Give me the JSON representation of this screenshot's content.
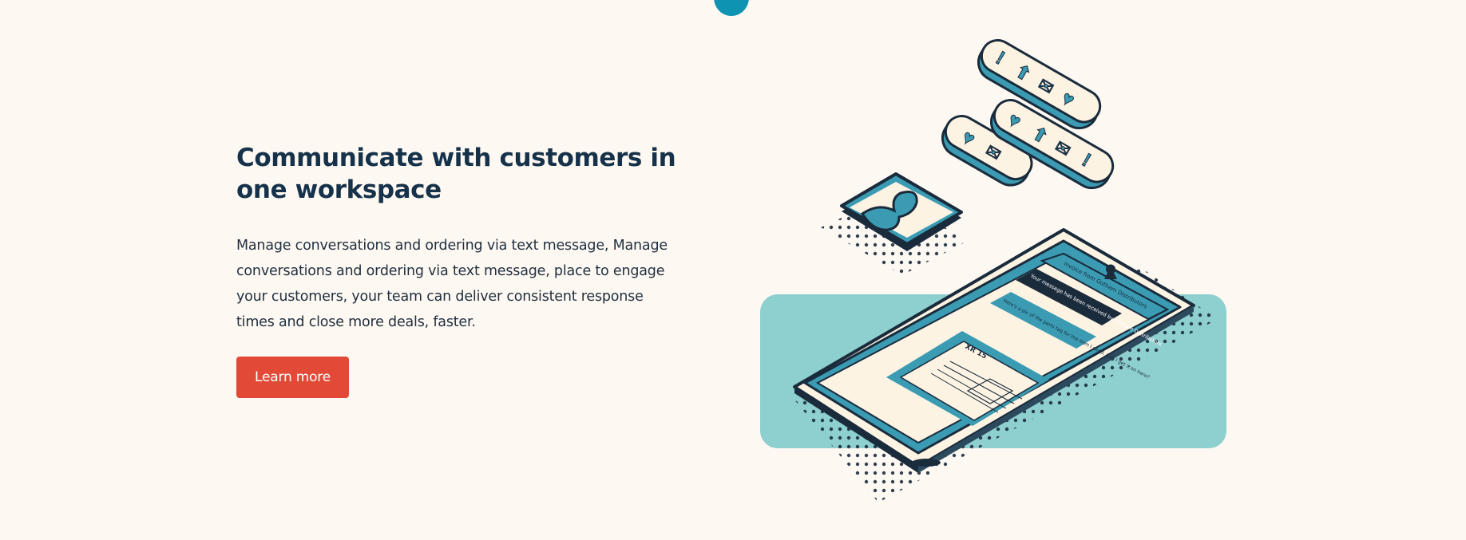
{
  "section": {
    "title": "Communicate with customers in one workspace",
    "description": "Manage conversations and ordering via text message, Manage conversations and ordering via text message, place to engage your customers, your team can deliver consistent response times and close more deals, faster.",
    "cta_label": "Learn more"
  },
  "illustration": {
    "contact_name": "Invoice from Gotham Distributors",
    "message_1": "Your message has been received by Gotham Distributors",
    "message_2": "Here's a pic of the parts tag for the item I need. Can I get it on here?",
    "tag_label": "XR 15",
    "icons": [
      "heart-icon",
      "mail-icon",
      "arrow-up-icon",
      "user-icon",
      "exclamation-icon"
    ]
  },
  "colors": {
    "background": "#fef8f2",
    "heading": "#16324a",
    "accent_teal": "#3a9bb3",
    "light_teal": "#8ecfcf",
    "cta": "#e24a37",
    "navy": "#1a2b3c"
  }
}
